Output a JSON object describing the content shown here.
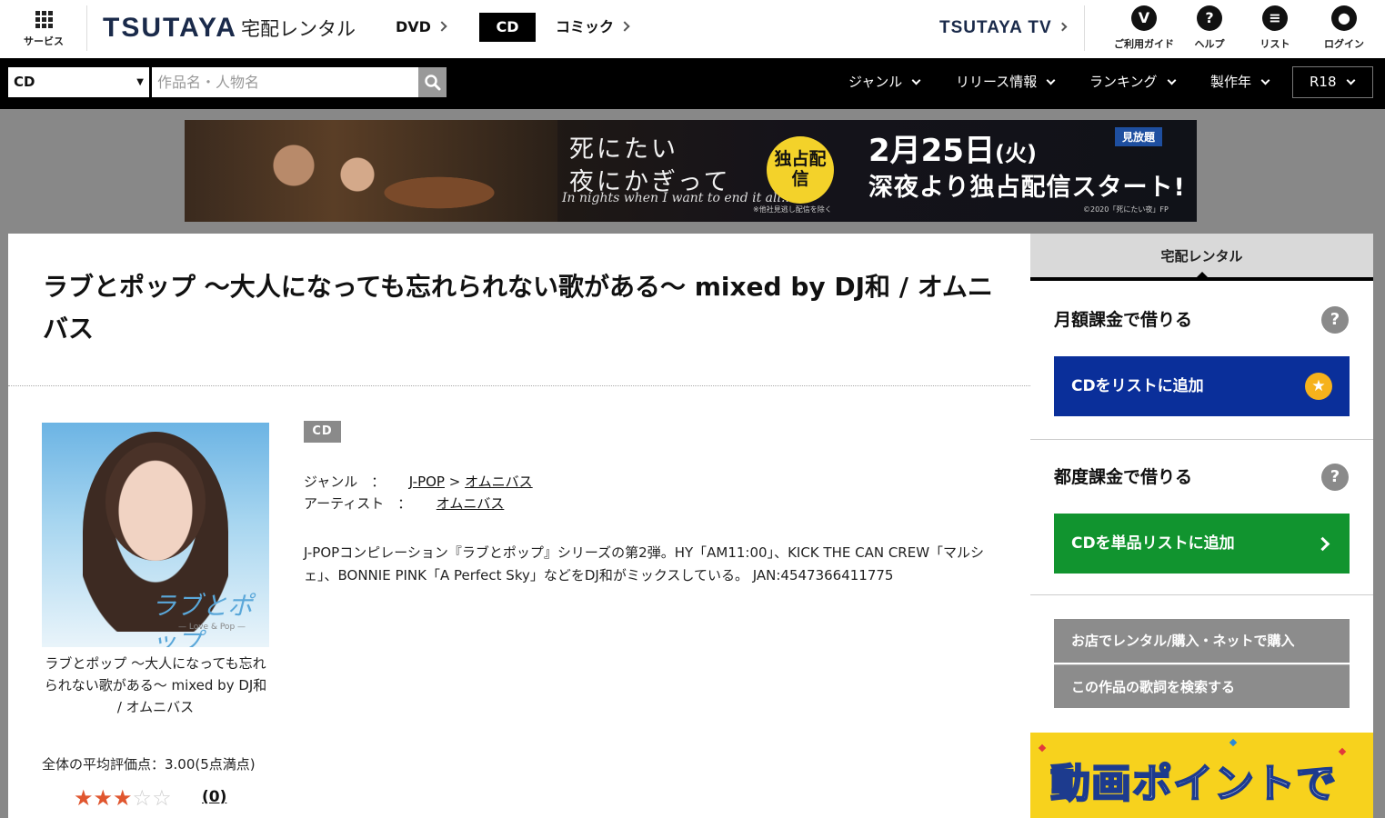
{
  "header": {
    "service_label": "サービス",
    "logo": "TSUTAYA",
    "logo_sub": "宅配レンタル",
    "nav": [
      "DVD",
      "CD",
      "コミック"
    ],
    "tv_link": "TSUTAYA TV",
    "util": [
      {
        "icon": "v-shield-icon",
        "glyph": "V",
        "label": "ご利用ガイド"
      },
      {
        "icon": "help-icon",
        "glyph": "?",
        "label": "ヘルプ"
      },
      {
        "icon": "list-icon",
        "glyph": "≡",
        "label": "リスト"
      },
      {
        "icon": "user-icon",
        "glyph": "●",
        "label": "ログイン"
      }
    ]
  },
  "search": {
    "category": "CD",
    "placeholder": "作品名・人物名",
    "nav": [
      "ジャンル",
      "リリース情報",
      "ランキング",
      "製作年"
    ],
    "rating_filter": "R18"
  },
  "banner": {
    "line1": "死にたい",
    "line2": "夜にかぎって",
    "script": "In nights when I want to end it all...",
    "circle": "独占配信",
    "note": "※他社見逃し配信を除く",
    "date_main": "2月25日",
    "date_day": "(火)",
    "desc": "深夜より独占配信スタート!",
    "badge": "見放題",
    "copyright": "©2020「死にたい夜」FP"
  },
  "product": {
    "title": "ラブとポップ ～大人になっても忘れられない歌がある～ mixed by DJ和 / オムニバス",
    "jacket_logo": "ラブとポップ",
    "jacket_sub": "— Love & Pop —",
    "caption": "ラブとポップ ～大人になっても忘れられない歌がある～ mixed by DJ和 / オムニバス",
    "tag": "CD",
    "genre_label": "ジャンル　：",
    "genre_1": "J-POP",
    "genre_sep": ">",
    "genre_2": "オムニバス",
    "artist_label": "アーティスト　：",
    "artist": "オムニバス",
    "description": "J-POPコンピレーション『ラブとポップ』シリーズの第2弾。HY「AM11:00」、KICK THE CAN CREW「マルシェ」、BONNIE PINK「A Perfect Sky」などをDJ和がミックスしている。 JAN:4547366411775",
    "rating_label": "全体の平均評価点：3.00(5点満点)",
    "rating_value": 3,
    "rating_max": 5,
    "review_count": "(0)"
  },
  "sidebar": {
    "tab": "宅配レンタル",
    "monthly_heading": "月額課金で借りる",
    "monthly_button": "CDをリストに追加",
    "per_heading": "都度課金で借りる",
    "per_button": "CDを単品リストに追加",
    "store_button": "お店でレンタル/購入・ネットで購入",
    "lyrics_button": "この作品の歌詞を検索する",
    "ad_text": "動画ポイントで"
  },
  "colors": {
    "blue_button": "#0a2f9a",
    "green_button": "#11942f",
    "gray_button": "#8c8c8c",
    "star_on": "#e0562f",
    "ad_yellow": "#f7d21d"
  }
}
